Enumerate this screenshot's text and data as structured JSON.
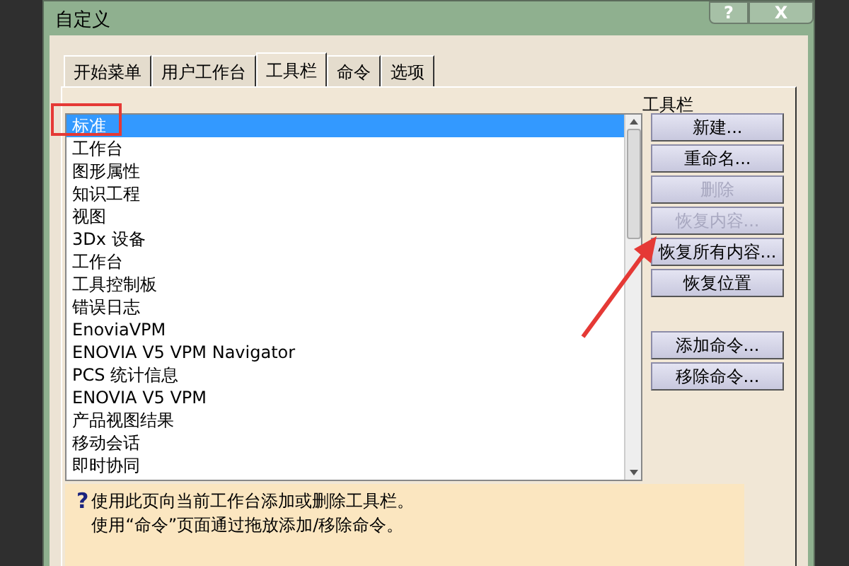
{
  "window": {
    "title": "自定义",
    "title_buttons": [
      {
        "kind": "help",
        "label": "?"
      },
      {
        "kind": "close",
        "label": "X"
      }
    ]
  },
  "tabs": [
    {
      "label": "开始菜单",
      "selected": false
    },
    {
      "label": "用户工作台",
      "selected": false
    },
    {
      "label": "工具栏",
      "selected": true
    },
    {
      "label": "命令",
      "selected": false
    },
    {
      "label": "选项",
      "selected": false
    }
  ],
  "toolbars": {
    "heading": "工具栏",
    "items": [
      {
        "label": "标准",
        "selected": true
      },
      {
        "label": "工作台",
        "selected": false
      },
      {
        "label": "图形属性",
        "selected": false
      },
      {
        "label": "知识工程",
        "selected": false
      },
      {
        "label": "视图",
        "selected": false
      },
      {
        "label": "3Dx 设备",
        "selected": false
      },
      {
        "label": "工作台",
        "selected": false
      },
      {
        "label": "工具控制板",
        "selected": false
      },
      {
        "label": "错误日志",
        "selected": false
      },
      {
        "label": "EnoviaVPM",
        "selected": false
      },
      {
        "label": "ENOVIA V5 VPM Navigator",
        "selected": false
      },
      {
        "label": "PCS 统计信息",
        "selected": false
      },
      {
        "label": "ENOVIA V5 VPM",
        "selected": false
      },
      {
        "label": "产品视图结果",
        "selected": false
      },
      {
        "label": "移动会话",
        "selected": false
      },
      {
        "label": "即时协同",
        "selected": false
      }
    ]
  },
  "buttons": [
    {
      "label": "新建...",
      "disabled": false
    },
    {
      "label": "重命名...",
      "disabled": false
    },
    {
      "label": "删除",
      "disabled": true
    },
    {
      "label": "恢复内容...",
      "disabled": true
    },
    {
      "label": "恢复所有内容...",
      "disabled": false
    },
    {
      "label": "恢复位置",
      "disabled": false
    }
  ],
  "command_buttons": [
    {
      "label": "添加命令...",
      "disabled": false
    },
    {
      "label": "移除命令...",
      "disabled": false
    }
  ],
  "help": {
    "icon": "?",
    "lines": [
      "使用此页向当前工作台添加或删除工具栏。",
      "使用“命令”页面通过拖放添加/移除命令。"
    ]
  }
}
